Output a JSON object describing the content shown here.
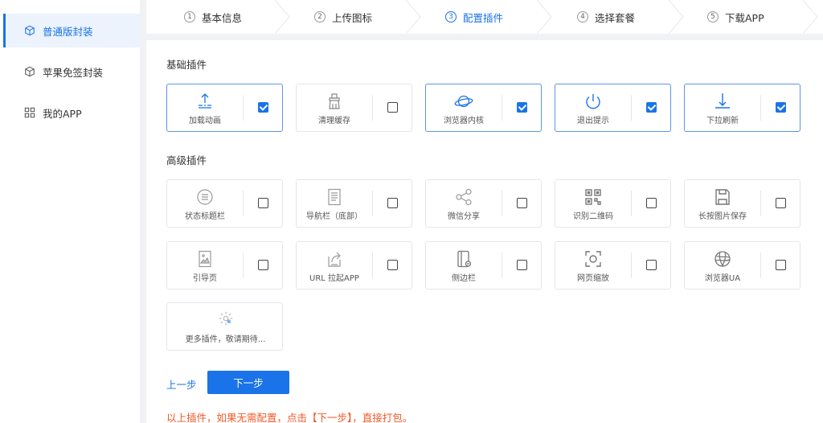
{
  "sidebar": {
    "items": [
      {
        "label": "普通版封装",
        "icon": "cube-icon",
        "active": true
      },
      {
        "label": "苹果免签封装",
        "icon": "cube-icon",
        "active": false
      },
      {
        "label": "我的APP",
        "icon": "grid-icon",
        "active": false
      }
    ]
  },
  "steps": [
    {
      "num": "1",
      "label": "基本信息"
    },
    {
      "num": "2",
      "label": "上传图标"
    },
    {
      "num": "3",
      "label": "配置插件",
      "active": true
    },
    {
      "num": "4",
      "label": "选择套餐"
    },
    {
      "num": "5",
      "label": "下载APP"
    }
  ],
  "basic": {
    "title": "基础插件",
    "plugins": [
      {
        "label": "加载动画",
        "icon": "upload-loading-icon",
        "checked": true
      },
      {
        "label": "清理缓存",
        "icon": "broom-icon",
        "checked": false
      },
      {
        "label": "浏览器内核",
        "icon": "planet-icon",
        "checked": true
      },
      {
        "label": "退出提示",
        "icon": "power-icon",
        "checked": true
      },
      {
        "label": "下拉刷新",
        "icon": "pull-down-icon",
        "checked": true
      }
    ]
  },
  "advanced": {
    "title": "高级插件",
    "plugins": [
      {
        "label": "状态标题栏",
        "icon": "list-circle-icon",
        "checked": false
      },
      {
        "label": "导航栏（底部）",
        "icon": "document-icon",
        "checked": false
      },
      {
        "label": "微信分享",
        "icon": "share-icon",
        "checked": false
      },
      {
        "label": "识别二维码",
        "icon": "qrcode-icon",
        "checked": false
      },
      {
        "label": "长按图片保存",
        "icon": "save-icon",
        "checked": false
      },
      {
        "label": "引导页",
        "icon": "image-page-icon",
        "checked": false
      },
      {
        "label": "URL 拉起APP",
        "icon": "launch-app-icon",
        "checked": false
      },
      {
        "label": "侧边栏",
        "icon": "sidebar-phone-icon",
        "checked": false
      },
      {
        "label": "网页缩放",
        "icon": "zoom-frame-icon",
        "checked": false
      },
      {
        "label": "浏览器UA",
        "icon": "globe-icon",
        "checked": false
      }
    ]
  },
  "more": {
    "label": "更多插件，敬请期待...",
    "icon": "gear-icon"
  },
  "actions": {
    "prev": "上一步",
    "next": "下一步"
  },
  "notice": "以上插件，如果无需配置，点击【下一步】，直接打包。",
  "colors": {
    "accent": "#1a73e8",
    "notice": "#f05a28",
    "border": "#e4e6ea"
  }
}
